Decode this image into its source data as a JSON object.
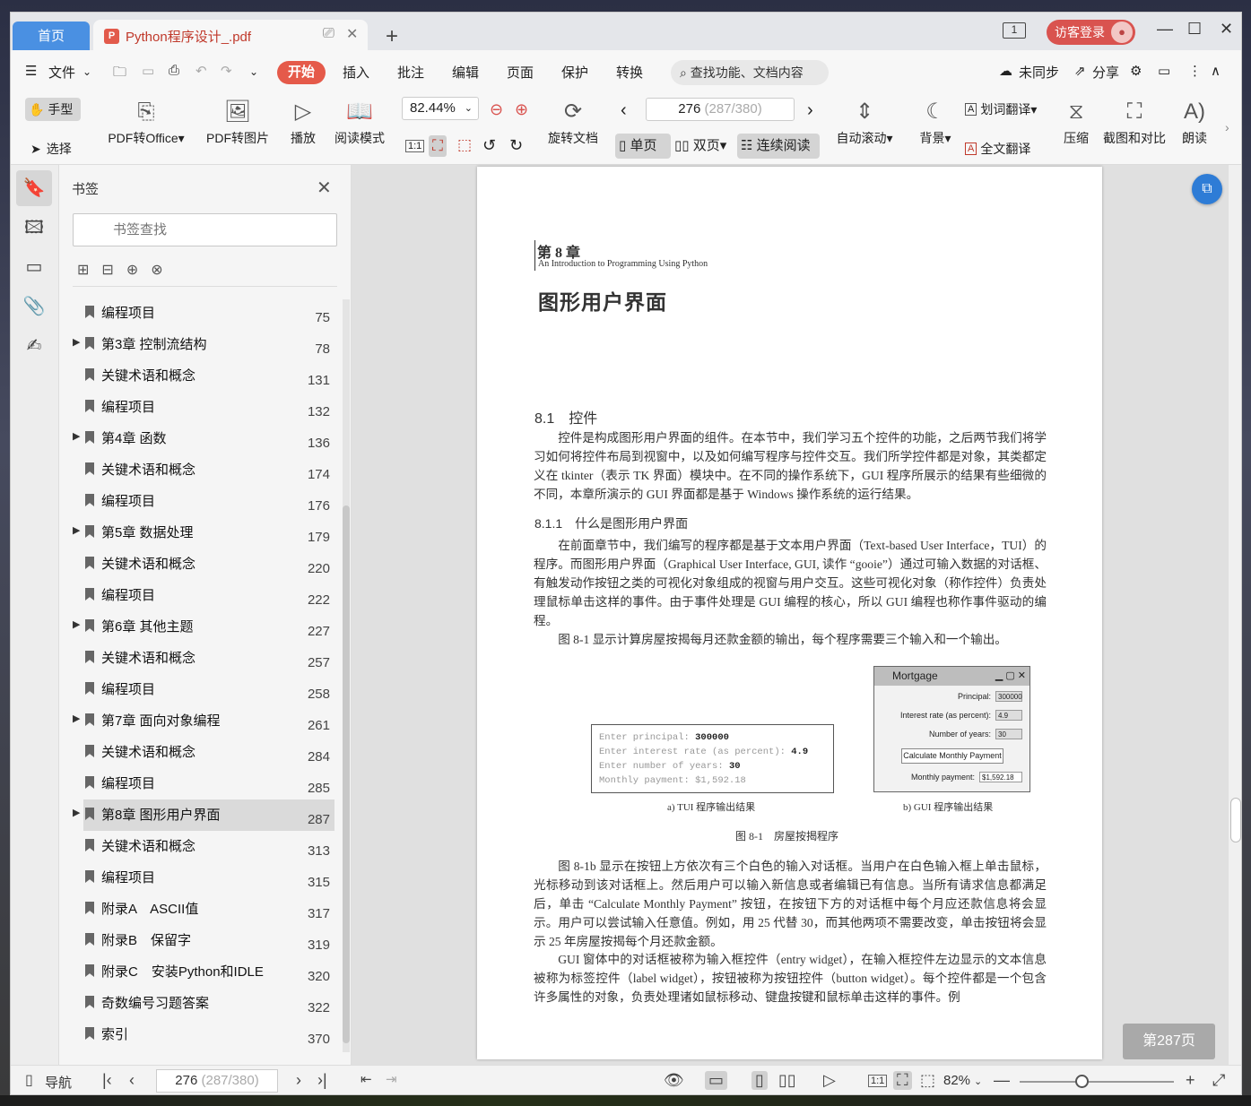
{
  "tabs": {
    "home": "首页",
    "doc": "Python程序设计_.pdf"
  },
  "header": {
    "login": "访客登录",
    "page_indicator": "1"
  },
  "menu": {
    "file": "文件",
    "items": [
      "开始",
      "插入",
      "批注",
      "编辑",
      "页面",
      "保护",
      "转换"
    ],
    "search": "查找功能、文档内容",
    "sync": "未同步",
    "share": "分享"
  },
  "toolbar": {
    "hand": "手型",
    "select": "选择",
    "pdf_to_office": "PDF转Office",
    "pdf_to_image": "PDF转图片",
    "play": "播放",
    "read_mode": "阅读模式",
    "zoom": "82.44%",
    "rotate": "旋转文档",
    "page_current": "276",
    "page_extra": "(287/380)",
    "single": "单页",
    "double": "双页",
    "continuous": "连续阅读",
    "auto_scroll": "自动滚动",
    "background": "背景",
    "word_translate": "划词翻译",
    "full_translate": "全文翻译",
    "compress": "压缩",
    "screenshot_compare": "截图和对比",
    "read_aloud": "朗读",
    "ratio": "1:1"
  },
  "panel": {
    "title": "书签",
    "search_placeholder": "书签查找"
  },
  "bookmarks": [
    {
      "label": "编程项目",
      "page": "75",
      "expand": false,
      "sel": false
    },
    {
      "label": "第3章 控制流结构",
      "page": "78",
      "expand": true,
      "sel": false
    },
    {
      "label": "关键术语和概念",
      "page": "131",
      "expand": false,
      "sel": false
    },
    {
      "label": "编程项目",
      "page": "132",
      "expand": false,
      "sel": false
    },
    {
      "label": "第4章 函数",
      "page": "136",
      "expand": true,
      "sel": false
    },
    {
      "label": "关键术语和概念",
      "page": "174",
      "expand": false,
      "sel": false
    },
    {
      "label": "编程项目",
      "page": "176",
      "expand": false,
      "sel": false
    },
    {
      "label": "第5章 数据处理",
      "page": "179",
      "expand": true,
      "sel": false
    },
    {
      "label": "关键术语和概念",
      "page": "220",
      "expand": false,
      "sel": false
    },
    {
      "label": "编程项目",
      "page": "222",
      "expand": false,
      "sel": false
    },
    {
      "label": "第6章 其他主题",
      "page": "227",
      "expand": true,
      "sel": false
    },
    {
      "label": "关键术语和概念",
      "page": "257",
      "expand": false,
      "sel": false
    },
    {
      "label": "编程项目",
      "page": "258",
      "expand": false,
      "sel": false
    },
    {
      "label": "第7章 面向对象编程",
      "page": "261",
      "expand": true,
      "sel": false
    },
    {
      "label": "关键术语和概念",
      "page": "284",
      "expand": false,
      "sel": false
    },
    {
      "label": "编程项目",
      "page": "285",
      "expand": false,
      "sel": false
    },
    {
      "label": "第8章 图形用户界面",
      "page": "287",
      "expand": true,
      "sel": true
    },
    {
      "label": "关键术语和概念",
      "page": "313",
      "expand": false,
      "sel": false
    },
    {
      "label": "编程项目",
      "page": "315",
      "expand": false,
      "sel": false
    },
    {
      "label": "附录A　ASCII值",
      "page": "317",
      "expand": false,
      "sel": false
    },
    {
      "label": "附录B　保留字",
      "page": "319",
      "expand": false,
      "sel": false
    },
    {
      "label": "附录C　安装Python和IDLE",
      "page": "320",
      "expand": false,
      "sel": false
    },
    {
      "label": "奇数编号习题答案",
      "page": "322",
      "expand": false,
      "sel": false
    },
    {
      "label": "索引",
      "page": "370",
      "expand": false,
      "sel": false
    }
  ],
  "page": {
    "chapter": "第 8 章",
    "chapter_en": "An Introduction to Programming Using Python",
    "title": "图形用户界面",
    "sec1": "8.1　控件",
    "p1": "控件是构成图形用户界面的组件。在本节中，我们学习五个控件的功能，之后两节我们将学习如何将控件布局到视窗中，以及如何编写程序与控件交互。我们所学控件都是对象，其类都定义在 tkinter（表示 TK 界面）模块中。在不同的操作系统下，GUI 程序所展示的结果有些细微的不同，本章所演示的 GUI 界面都是基于 Windows 操作系统的运行结果。",
    "sec11": "8.1.1　什么是图形用户界面",
    "p2": "在前面章节中，我们编写的程序都是基于文本用户界面（Text-based User Interface，TUI）的程序。而图形用户界面（Graphical User Interface, GUI, 读作 “gooie”）通过可输入数据的对话框、有触发动作按钮之类的可视化对象组成的视窗与用户交互。这些可视化对象（称作控件）负责处理鼠标单击这样的事件。由于事件处理是 GUI 编程的核心，所以 GUI 编程也称作事件驱动的编程。",
    "p3": "图 8-1 显示计算房屋按揭每月还款金额的输出，每个程序需要三个输入和一个输出。",
    "tui_lines": [
      {
        "k": "Enter principal: ",
        "v": "300000"
      },
      {
        "k": "Enter interest rate (as percent): ",
        "v": "4.9"
      },
      {
        "k": "Enter number of years: ",
        "v": "30"
      },
      {
        "k": "Monthly payment: ",
        "v": "$1,592.18"
      }
    ],
    "gui": {
      "title": "Mortgage",
      "principal_label": "Principal:",
      "principal": "300000",
      "rate_label": "Interest rate (as percent):",
      "rate": "4.9",
      "years_label": "Number of years:",
      "years": "30",
      "button": "Calculate Monthly Payment",
      "payment_label": "Monthly payment:",
      "payment": "$1,592.18"
    },
    "cap_a": "a) TUI 程序输出结果",
    "cap_b": "b) GUI 程序输出结果",
    "fig_cap": "图 8-1　房屋按揭程序",
    "p4": "图 8-1b 显示在按钮上方依次有三个白色的输入对话框。当用户在白色输入框上单击鼠标，光标移动到该对话框上。然后用户可以输入新信息或者编辑已有信息。当所有请求信息都满足后，单击 “Calculate Monthly Payment” 按钮，在按钮下方的对话框中每个月应还款信息将会显示。用户可以尝试输入任意值。例如，用 25 代替 30，而其他两项不需要改变，单击按钮将会显示 25 年房屋按揭每个月还款金额。",
    "p5": "GUI 窗体中的对话框被称为输入框控件（entry widget），在输入框控件左边显示的文本信息被称为标签控件（label widget），按钮被称为按钮控件（button widget）。每个控件都是一个包含许多属性的对象，负责处理诸如鼠标移动、键盘按键和鼠标单击这样的事件。例",
    "badge": "第287页"
  },
  "status": {
    "nav": "导航",
    "page_current": "276",
    "page_extra": "(287/380)",
    "zoom": "82%",
    "ratio": "1:1"
  }
}
